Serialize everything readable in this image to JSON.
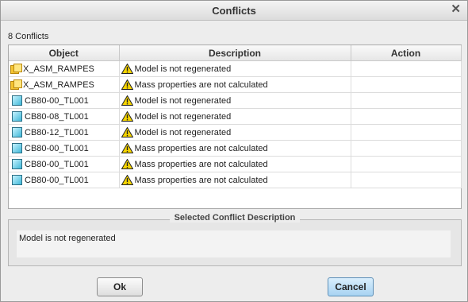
{
  "window": {
    "title": "Conflicts"
  },
  "conflicts": {
    "count_label": "8 Conflicts"
  },
  "table": {
    "headers": [
      "Object",
      "Description",
      "Action"
    ],
    "rows": [
      {
        "icon": "assembly-icon",
        "object": "X_ASM_RAMPES",
        "description": "Model is not regenerated",
        "action": ""
      },
      {
        "icon": "assembly-icon",
        "object": "X_ASM_RAMPES",
        "description": "Mass properties are not calculated",
        "action": ""
      },
      {
        "icon": "part-icon",
        "object": "CB80-00_TL001",
        "description": "Model is not regenerated",
        "action": ""
      },
      {
        "icon": "part-icon",
        "object": "CB80-08_TL001",
        "description": "Model is not regenerated",
        "action": ""
      },
      {
        "icon": "part-icon",
        "object": "CB80-12_TL001",
        "description": "Model is not regenerated",
        "action": ""
      },
      {
        "icon": "part-icon",
        "object": "CB80-00_TL001",
        "description": "Mass properties are not calculated",
        "action": ""
      },
      {
        "icon": "part-icon",
        "object": "CB80-00_TL001",
        "description": "Mass properties are not calculated",
        "action": ""
      },
      {
        "icon": "part-icon",
        "object": "CB80-00_TL001",
        "description": "Mass properties are not calculated",
        "action": ""
      }
    ]
  },
  "selected_conflict": {
    "title": "Selected Conflict Description",
    "text": "Model is not regenerated"
  },
  "buttons": {
    "ok": "Ok",
    "cancel": "Cancel"
  },
  "colors": {
    "warning": "#f5d400",
    "cancel_accent": "#a8d3f2"
  }
}
